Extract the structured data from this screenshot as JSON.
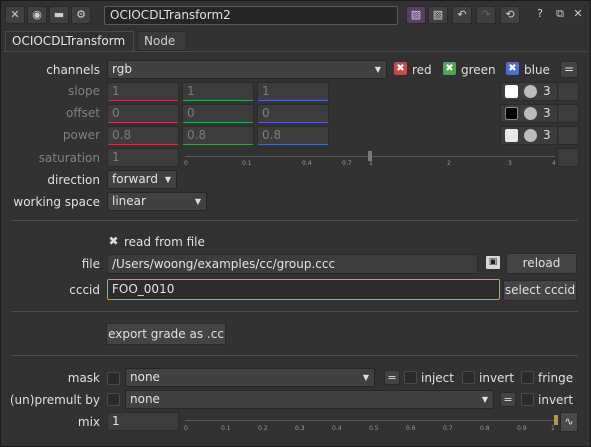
{
  "node_name": "OCIOCDLTransform2",
  "tabs": [
    "OCIOCDLTransform",
    "Node"
  ],
  "channels": {
    "label": "channels",
    "value": "rgb",
    "red": "red",
    "green": "green",
    "blue": "blue",
    "eq": "="
  },
  "slope": {
    "label": "slope",
    "values": [
      "1",
      "1",
      "1"
    ],
    "count": "3"
  },
  "offset": {
    "label": "offset",
    "values": [
      "0",
      "0",
      "0"
    ],
    "count": "3"
  },
  "power": {
    "label": "power",
    "values": [
      "0.8",
      "0.8",
      "0.8"
    ],
    "count": "3"
  },
  "saturation": {
    "label": "saturation",
    "value": "1",
    "ticks": [
      "0",
      "0.1",
      "0.4",
      "0.7",
      "1",
      "2",
      "3",
      "4"
    ]
  },
  "direction": {
    "label": "direction",
    "value": "forward"
  },
  "working_space": {
    "label": "working space",
    "value": "linear"
  },
  "read_from_file": {
    "label": "read from file",
    "checked": true
  },
  "file": {
    "label": "file",
    "value": "/Users/woong/examples/cc/group.ccc",
    "reload": "reload"
  },
  "cccid": {
    "label": "cccid",
    "value": "FOO_0010",
    "select": "select cccid"
  },
  "export_button": "export grade as .cc",
  "mask": {
    "label": "mask",
    "value": "none",
    "eq": "=",
    "inject": "inject",
    "invert": "invert",
    "fringe": "fringe"
  },
  "unpremult": {
    "label": "(un)premult by",
    "value": "none",
    "eq": "=",
    "invert": "invert"
  },
  "mix": {
    "label": "mix",
    "value": "1",
    "ticks": [
      "0",
      "0.1",
      "0.2",
      "0.3",
      "0.4",
      "0.5",
      "0.6",
      "0.7",
      "0.8",
      "0.9",
      "1"
    ]
  },
  "colors": {
    "red_check": "#c94a4a",
    "green_check": "#4ea64e",
    "blue_check": "#4f6fd0",
    "focus": "#e09a36"
  }
}
